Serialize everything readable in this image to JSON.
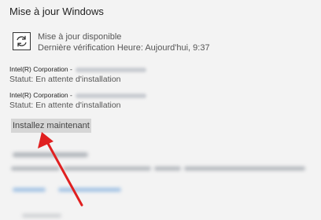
{
  "window": {
    "title": "Mise à jour Windows"
  },
  "status": {
    "icon": "refresh-icon",
    "title": "Mise à jour disponible",
    "last_check": "Dernière vérification Heure: Aujourd'hui, 9:37"
  },
  "updates": [
    {
      "name": "Intel(R) Corporation -",
      "status": "Statut: En attente d'installation"
    },
    {
      "name": "Intel(R) Corporation -",
      "status": "Statut: En attente d'installation"
    }
  ],
  "install_button": {
    "label": "Installez maintenant"
  },
  "annotation": {
    "arrow_color": "#e02020"
  }
}
